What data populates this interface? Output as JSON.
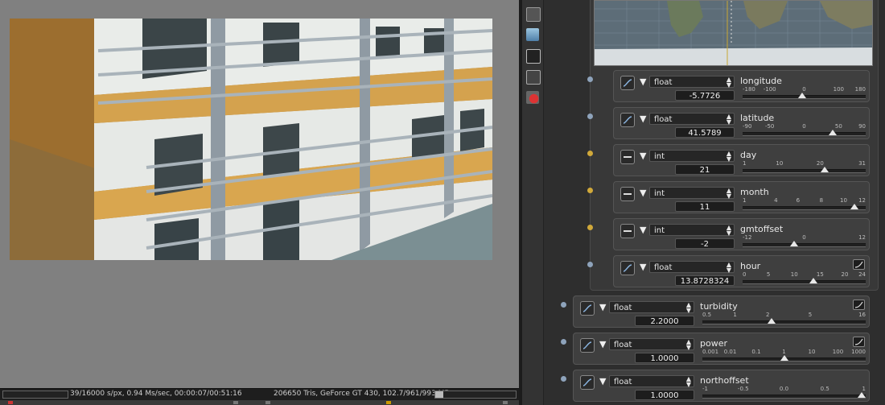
{
  "status": {
    "render_stats": "39/16000 s/px, 0.94 Ms/sec, 00:00:07/00:51:16",
    "scene_stats": "206650 Tris, GeForce GT 430, 102.7/961/993 MB"
  },
  "tools": [
    "tabs-icon",
    "layers-icon",
    "image-icon",
    "filter-icon",
    "material-icon"
  ],
  "params": [
    {
      "type": "float",
      "name": "longitude",
      "value": "-5.7726",
      "port": "blue",
      "ctrl": "curve",
      "ticks": [
        "-180",
        "-100",
        "0",
        "100",
        "180"
      ],
      "ticks_fraction": [
        0,
        0.22,
        0.5,
        0.78,
        1
      ],
      "thumb_fraction": 0.484,
      "expr": false
    },
    {
      "type": "float",
      "name": "latitude",
      "value": "41.5789",
      "port": "blue",
      "ctrl": "curve",
      "ticks": [
        "-90",
        "-50",
        "0",
        "50",
        "90"
      ],
      "ticks_fraction": [
        0,
        0.22,
        0.5,
        0.78,
        1
      ],
      "thumb_fraction": 0.731,
      "expr": false
    },
    {
      "type": "int",
      "name": "day",
      "value": "21",
      "port": "gold",
      "ctrl": "box",
      "ticks": [
        "1",
        "10",
        "20",
        "31"
      ],
      "ticks_fraction": [
        0,
        0.3,
        0.63,
        1
      ],
      "thumb_fraction": 0.667,
      "expr": false
    },
    {
      "type": "int",
      "name": "month",
      "value": "11",
      "port": "gold",
      "ctrl": "box",
      "ticks": [
        "1",
        "4",
        "6",
        "8",
        "10",
        "12"
      ],
      "ticks_fraction": [
        0,
        0.27,
        0.45,
        0.64,
        0.82,
        1
      ],
      "thumb_fraction": 0.909,
      "expr": false
    },
    {
      "type": "int",
      "name": "gmtoffset",
      "value": "-2",
      "port": "gold",
      "ctrl": "box",
      "ticks": [
        "-12",
        "0",
        "12"
      ],
      "ticks_fraction": [
        0,
        0.5,
        1
      ],
      "thumb_fraction": 0.417,
      "expr": false
    },
    {
      "type": "float",
      "name": "hour",
      "value": "13.8728324",
      "port": "blue",
      "ctrl": "curve",
      "ticks": [
        "0",
        "5",
        "10",
        "15",
        "20",
        "24"
      ],
      "ticks_fraction": [
        0,
        0.21,
        0.42,
        0.63,
        0.83,
        1
      ],
      "thumb_fraction": 0.578,
      "expr": true
    },
    {
      "type": "float",
      "name": "turbidity",
      "value": "2.2000",
      "port": "blue",
      "ctrl": "curve",
      "ticks": [
        "0.5",
        "1",
        "2",
        "5",
        "16"
      ],
      "ticks_fraction": [
        0,
        0.2,
        0.4,
        0.66,
        1
      ],
      "thumb_fraction": 0.425,
      "expr": true
    },
    {
      "type": "float",
      "name": "power",
      "value": "1.0000",
      "port": "blue",
      "ctrl": "curve",
      "ticks": [
        "0.001",
        "0.01",
        "0.1",
        "1",
        "10",
        "100",
        "1000"
      ],
      "ticks_fraction": [
        0,
        0.17,
        0.33,
        0.5,
        0.67,
        0.83,
        1
      ],
      "thumb_fraction": 0.5,
      "expr": true
    },
    {
      "type": "float",
      "name": "northoffset",
      "value": "1.0000",
      "port": "blue",
      "ctrl": "curve",
      "ticks": [
        "-1",
        "-0.5",
        "0.0",
        "0.5",
        "1"
      ],
      "ticks_fraction": [
        0,
        0.25,
        0.5,
        0.75,
        1
      ],
      "thumb_fraction": 1.0,
      "expr": false
    }
  ]
}
